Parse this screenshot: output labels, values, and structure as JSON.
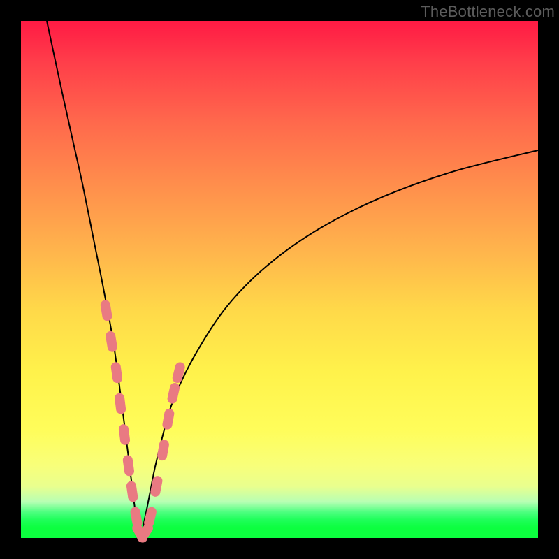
{
  "watermark": "TheBottleneck.com",
  "colors": {
    "background_frame": "#000000",
    "curve": "#000000",
    "marker_fill": "#e97a82",
    "gradient_top": "#ff1a44",
    "gradient_mid1": "#ff8f4c",
    "gradient_mid2": "#fff24b",
    "gradient_bottom": "#0cff3f"
  },
  "chart_data": {
    "type": "line",
    "title": "",
    "xlabel": "",
    "ylabel": "",
    "xlim": [
      0,
      100
    ],
    "ylim": [
      0,
      100
    ],
    "grid": false,
    "note": "V-shaped bottleneck curve. y ≈ |x - x_min| scaled; minimum near x≈23, y≈0; left branch rises steeply to top-left, right branch rises and tapers toward top-right. Values estimated from pixels (no axes shown).",
    "series": [
      {
        "name": "bottleneck-curve",
        "x": [
          5,
          8,
          10,
          12,
          14,
          16,
          18,
          20,
          21,
          22,
          23,
          24,
          25,
          26,
          28,
          30,
          34,
          40,
          48,
          58,
          70,
          84,
          100
        ],
        "y": [
          100,
          86,
          77,
          68,
          58,
          48,
          37,
          22,
          14,
          6,
          0,
          4,
          9,
          14,
          22,
          28,
          36,
          45,
          53,
          60,
          66,
          71,
          75
        ]
      }
    ],
    "markers": {
      "name": "highlighted-points",
      "note": "Pink lozenge markers clustered along lower portion of both branches; approximate positions.",
      "points": [
        {
          "x": 16.5,
          "y": 44
        },
        {
          "x": 17.5,
          "y": 38
        },
        {
          "x": 18.5,
          "y": 32
        },
        {
          "x": 19.2,
          "y": 26
        },
        {
          "x": 20.0,
          "y": 20
        },
        {
          "x": 20.8,
          "y": 14
        },
        {
          "x": 21.5,
          "y": 9
        },
        {
          "x": 22.3,
          "y": 4
        },
        {
          "x": 23.0,
          "y": 1
        },
        {
          "x": 24.0,
          "y": 1
        },
        {
          "x": 25.0,
          "y": 4
        },
        {
          "x": 26.2,
          "y": 10
        },
        {
          "x": 27.5,
          "y": 17
        },
        {
          "x": 28.5,
          "y": 23
        },
        {
          "x": 29.5,
          "y": 28
        },
        {
          "x": 30.5,
          "y": 32
        }
      ]
    }
  }
}
